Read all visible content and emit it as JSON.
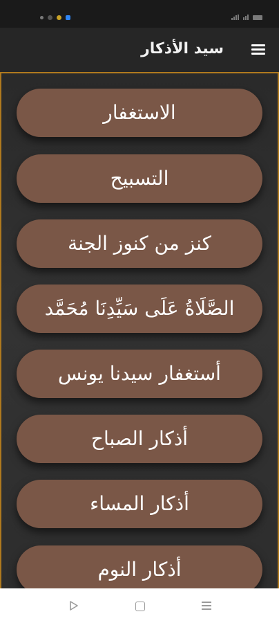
{
  "colors": {
    "status_bar_bg": "#1a1a1a",
    "app_bar_bg": "#262626",
    "content_border": "#b07a1e",
    "button_bg": "#7a5747",
    "button_text": "#ffffff",
    "nav_bar_bg": "#ffffff",
    "nav_icon": "#9a9a9a"
  },
  "status_bar": {
    "icons": [
      "notification-dot-icon",
      "facebook-icon",
      "app-icon",
      "messenger-icon"
    ],
    "right_icons": [
      "wifi-icon",
      "signal-icon",
      "battery-icon"
    ]
  },
  "app_bar": {
    "title": "سيد الأذكار",
    "menu_icon": "hamburger-menu-icon"
  },
  "azkar_buttons": [
    {
      "label": "الاستغفار"
    },
    {
      "label": "التسبيح"
    },
    {
      "label": "كنز من كنوز الجنة"
    },
    {
      "label": "الصَّلَاةُ عَلَى سَيِّدِنَا مُحَمَّد"
    },
    {
      "label": "أستغفار سيدنا يونس"
    },
    {
      "label": "أذكار الصباح"
    },
    {
      "label": "أذكار المساء"
    },
    {
      "label": "أذكار النوم"
    }
  ],
  "nav_bar": {
    "icons": [
      "back-triangle-icon",
      "home-square-icon",
      "recent-apps-icon"
    ]
  }
}
